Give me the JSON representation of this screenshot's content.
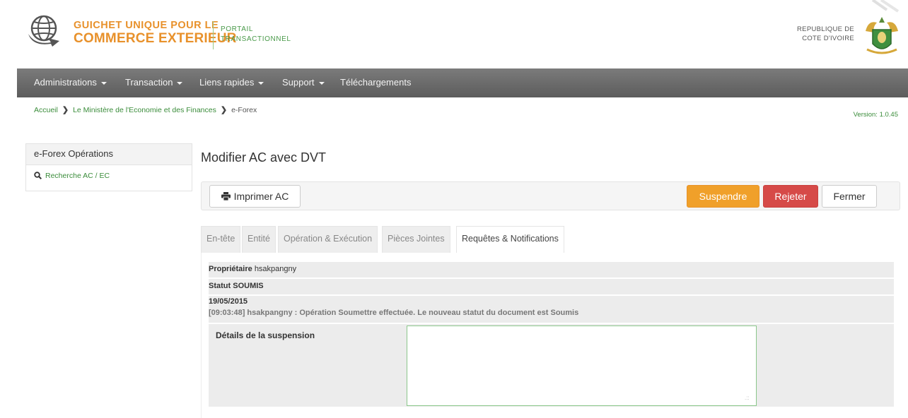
{
  "header": {
    "logo_line1": "GUICHET UNIQUE POUR LE",
    "logo_line2": "COMMERCE EXTERIEUR",
    "portal_line1": "PORTAIL",
    "portal_line2": "TRANSACTIONNEL",
    "republic_line1": "REPUBLIQUE DE",
    "republic_line2": "COTE D'IVOIRE"
  },
  "nav": {
    "items": [
      "Administrations",
      "Transaction",
      "Liens rapides",
      "Support",
      "Téléchargements"
    ]
  },
  "breadcrumb": {
    "items": [
      "Accueil",
      "Le Ministère de l'Economie et des Finances",
      "e-Forex"
    ]
  },
  "version": "Version: 1.0.45",
  "sidebar": {
    "title": "e-Forex Opérations",
    "items": [
      "Recherche AC / EC"
    ]
  },
  "page": {
    "title": "Modifier AC avec DVT"
  },
  "toolbar": {
    "print_label": "Imprimer AC",
    "suspend_label": "Suspendre",
    "reject_label": "Rejeter",
    "close_label": "Fermer"
  },
  "tabs": [
    "En-tête",
    "Entité",
    "Opération & Exécution",
    "Pièces Jointes",
    "Requêtes & Notifications"
  ],
  "active_tab": "Requêtes & Notifications",
  "details": {
    "owner_label": "Propriétaire",
    "owner_value": "hsakpangny",
    "status_label": "Statut",
    "status_value": "SOUMIS",
    "date": "19/05/2015",
    "log": "[09:03:48] hsakpangny : Opération Soumettre effectuée. Le nouveau statut du document est Soumis"
  },
  "suspension": {
    "label": "Détails de la suspension",
    "value": ""
  },
  "colors": {
    "brand_orange": "#e8912b",
    "brand_green": "#3a8c3a",
    "suspend": "#f0a02a",
    "reject": "#d64a48",
    "nav_bg": "#6b6b6b"
  }
}
